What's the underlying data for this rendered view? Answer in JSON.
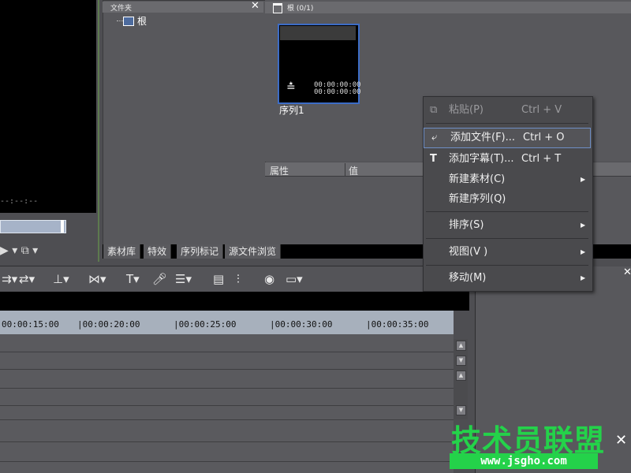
{
  "preview": {
    "timecode": "--:--:--",
    "controls": "▶ ▾ ⧉ ▾"
  },
  "folder_panel": {
    "title": "文件夹",
    "close": "✕",
    "root": "根"
  },
  "content_panel": {
    "title": "根 (0/1)",
    "clip": {
      "label": "序列1",
      "timecode_1": "00:00:00:00",
      "timecode_2": "00:00:00:00"
    }
  },
  "properties": {
    "col1": "属性",
    "col2": "值"
  },
  "tabs": [
    "素材库",
    "特效",
    "序列标记",
    "源文件浏览"
  ],
  "timeline": {
    "ruler": [
      "00:00:15:00",
      "|00:00:20:00",
      "|00:00:25:00",
      "|00:00:30:00",
      "|00:00:35:00"
    ]
  },
  "toolbar_icons": [
    "split-icon",
    "ripple-icon",
    "marker-icon",
    "link-icon",
    "text-icon",
    "mic-icon",
    "mixer-icon",
    "list-icon",
    "sliders-icon",
    "color-icon",
    "window-icon"
  ],
  "context_menu": {
    "items": [
      {
        "label": "粘贴(P)",
        "shortcut": "Ctrl + V",
        "disabled": true,
        "icon": "⧉"
      },
      {
        "label": "添加文件(F)...",
        "shortcut": "Ctrl + O",
        "highlighted": true,
        "icon": "⤶"
      },
      {
        "label": "添加字幕(T)...",
        "shortcut": "Ctrl + T",
        "icon": "T"
      },
      {
        "label": "新建素材(C)",
        "submenu": true
      },
      {
        "label": "新建序列(Q)"
      },
      {
        "label": "排序(S)",
        "submenu": true
      },
      {
        "label": "视图(V )",
        "submenu": true
      },
      {
        "label": "移动(M)",
        "submenu": true
      }
    ]
  },
  "watermark": {
    "text": "技术员联盟",
    "url": "www.jsgho.com"
  },
  "colors": {
    "accent": "#3c6cc6",
    "watermark": "#24d24a"
  }
}
